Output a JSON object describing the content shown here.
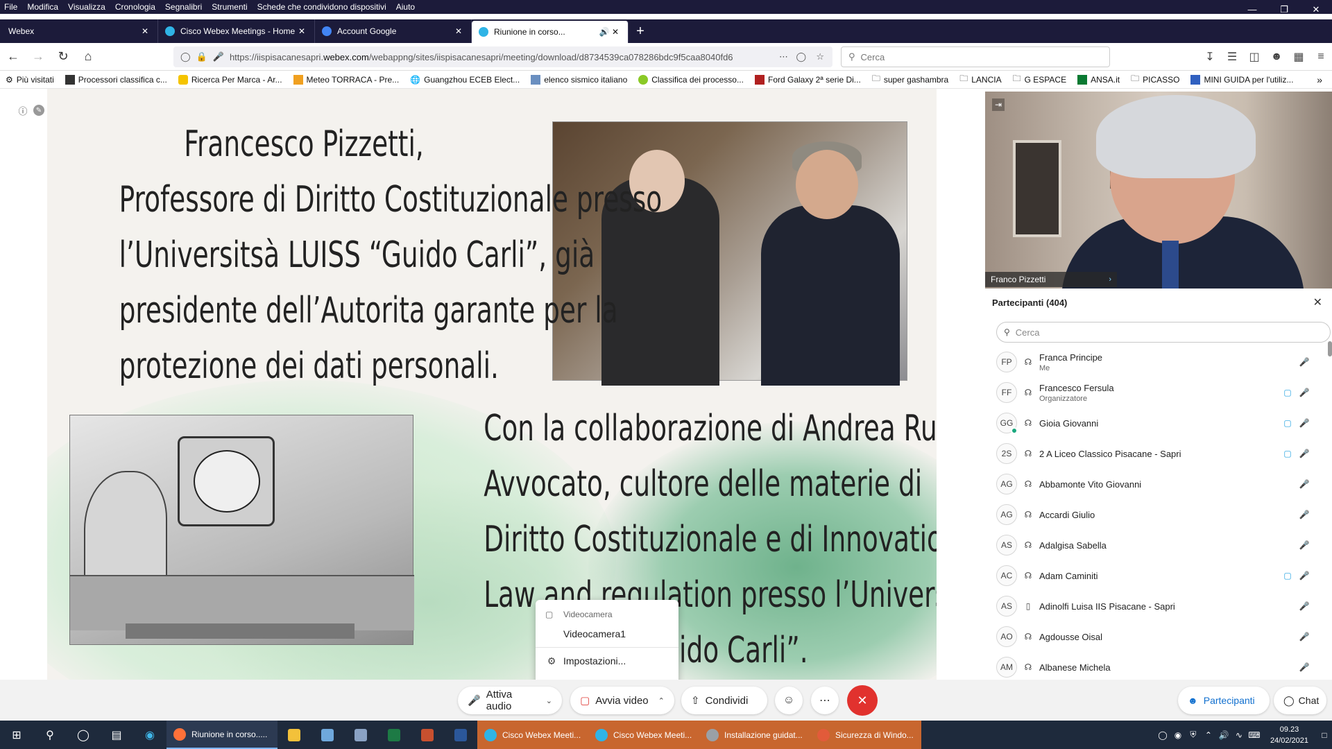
{
  "menu": [
    "File",
    "Modifica",
    "Visualizza",
    "Cronologia",
    "Segnalibri",
    "Strumenti",
    "Schede che condividono dispositivi",
    "Aiuto"
  ],
  "tabs": [
    {
      "title": "Webex",
      "fav": "#1c1b3a"
    },
    {
      "title": "Cisco Webex Meetings - Home",
      "fav": "#2fb4e6"
    },
    {
      "title": "Account Google",
      "fav": "#4285f4"
    },
    {
      "title": "Riunione in corso...",
      "fav": "#2fb4e6"
    }
  ],
  "url": {
    "prefix": "https://iispisacanesapri.",
    "domain": "webex.com",
    "path": "/webappng/sites/iispisacanesapri/meeting/download/d8734539ca078286bdc9f5caa8040fd6"
  },
  "search_placeholder": "Cerca",
  "bookmarks": [
    "Più visitati",
    "Processori classifica c...",
    "Ricerca Per Marca - Ar...",
    "Meteo TORRACA - Pre...",
    "Guangzhou ECEB Elect...",
    "elenco sismico italiano",
    "Classifica dei processo...",
    "Ford Galaxy 2ª serie Di...",
    "super gashambra",
    "LANCIA",
    "G ESPACE",
    "ANSA.it",
    "PICASSO",
    "MINI GUIDA per l'utiliz..."
  ],
  "slide": {
    "text1": [
      "Francesco Pizzetti,",
      "Professore di Diritto Costituzionale presso",
      "l’Universitsà LUISS “Guido Carli”, già",
      "presidente dell’Autorita  garante per la",
      "protezione dei dati personali."
    ],
    "text2": [
      "Con la collaborazione di Andrea Ruffo,",
      "Avvocato, cultore delle materie di",
      "Diritto Costituzionale e di Innovation",
      "Law and regulation presso l’Università",
      "LUISS “Guido Carli”."
    ]
  },
  "camera_menu": {
    "header": "Videocamera",
    "item": "Videocamera1",
    "settings": "Impostazioni..."
  },
  "video": {
    "speaker": "Franco Pizzetti"
  },
  "participants": {
    "title": "Partecipanti (404)",
    "search_placeholder": "Cerca",
    "list": [
      {
        "initials": "FP",
        "name": "Franca Principe",
        "sub": "Me",
        "video": false
      },
      {
        "initials": "FF",
        "name": "Francesco Fersula",
        "sub": "Organizzatore",
        "video": true
      },
      {
        "initials": "GG",
        "name": "Gioia Giovanni",
        "sub": "",
        "video": true
      },
      {
        "initials": "2S",
        "name": "2 A Liceo Classico Pisacane - Sapri",
        "sub": "",
        "video": true
      },
      {
        "initials": "AG",
        "name": "Abbamonte Vito Giovanni",
        "sub": "",
        "video": false
      },
      {
        "initials": "AG",
        "name": "Accardi Giulio",
        "sub": "",
        "video": false
      },
      {
        "initials": "AS",
        "name": "Adalgisa Sabella",
        "sub": "",
        "video": false
      },
      {
        "initials": "AC",
        "name": "Adam Caminiti",
        "sub": "",
        "video": true
      },
      {
        "initials": "AS",
        "name": "Adinolfi Luisa IIS Pisacane - Sapri",
        "sub": "",
        "video": false
      },
      {
        "initials": "AO",
        "name": "Agdousse Oisal",
        "sub": "",
        "video": false
      },
      {
        "initials": "AM",
        "name": "Albanese Michela",
        "sub": "",
        "video": false
      }
    ]
  },
  "controls": {
    "audio": "Attiva audio",
    "video": "Avvia video",
    "share": "Condividi",
    "participants": "Partecipanti",
    "chat": "Chat"
  },
  "taskbar": {
    "apps": [
      {
        "label": "Riunione in corso.....",
        "color": "#ff7139",
        "style": "hl"
      },
      {
        "label": "Cisco Webex Meeti...",
        "color": "#2fb4e6",
        "style": "orange"
      },
      {
        "label": "Cisco Webex Meeti...",
        "color": "#2fb4e6",
        "style": "orange"
      },
      {
        "label": "Installazione guidat...",
        "color": "#9aa0a6",
        "style": "orange"
      },
      {
        "label": "Sicurezza di Windo...",
        "color": "#e25b3a",
        "style": "orange"
      }
    ],
    "time": "09.23",
    "date": "24/02/2021"
  }
}
